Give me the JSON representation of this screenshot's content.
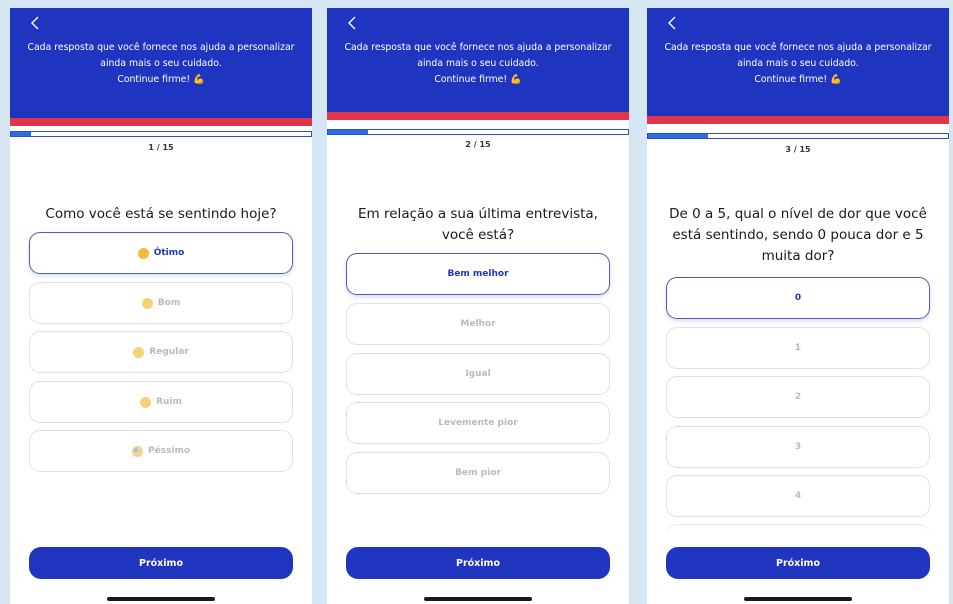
{
  "header": {
    "line1": "Cada resposta que você fornece nos ajuda a personalizar",
    "line2": "ainda mais o seu cuidado.",
    "line3": "Continue firme! 💪"
  },
  "next_label": "Próximo",
  "screens": [
    {
      "step": "1 / 15",
      "progress": 0.0667,
      "question": "Como você está se sentindo hoje?",
      "options": [
        "Ótimo",
        "Bom",
        "Regular",
        "Ruim",
        "Péssimo"
      ],
      "option_icons": [
        "grinning-emoji-icon",
        "smiling-emoji-icon",
        "neutral-emoji-icon",
        "sad-emoji-icon",
        "crying-emoji-icon"
      ],
      "selected": "Ótimo"
    },
    {
      "step": "2 / 15",
      "progress": 0.1333,
      "question": "Em relação a sua última entrevista, você está?",
      "options": [
        "Bem melhor",
        "Melhor",
        "Igual",
        "Levemente pior",
        "Bem pior"
      ],
      "selected": "Bem melhor"
    },
    {
      "step": "3 / 15",
      "progress": 0.2,
      "question": "De 0 a 5, qual o nível de dor que você está sentindo, sendo 0 pouca dor e 5 muita dor?",
      "options": [
        "0",
        "1",
        "2",
        "3",
        "4"
      ],
      "selected": "0"
    }
  ],
  "colors": {
    "header_blue": "#1f35c0",
    "accent_red": "#e0354b",
    "progress_blue": "#2c6ee0",
    "background": "#d6e6f3"
  }
}
